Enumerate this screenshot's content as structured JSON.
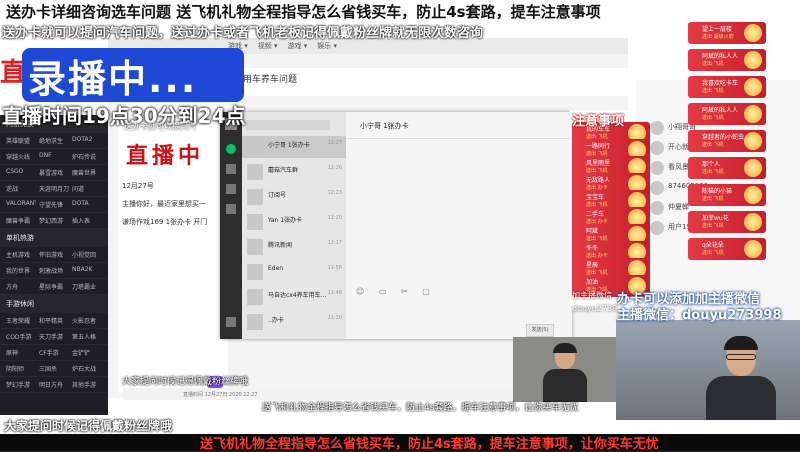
{
  "top_banner": "送办卡详细咨询选车问题  送飞机礼物全程指导怎么省钱买车，防止4s套路，提车注意事项",
  "line2": "送办卡就可以提问汽车问题，送过办卡或者飞机老板记得佩戴粉丝牌就无限次数咨询",
  "recording_label": "录播中...",
  "live_time": "直播时间19点30分到24点",
  "left_red_text": "直",
  "doc_red_text": "直播中",
  "sidebar_overlay_text": "送办卡就可以提问汽",
  "browser": {
    "nav": [
      "游戏 ▾",
      "视频 ▾",
      "游戏 ▾",
      "娱乐 ▾"
    ],
    "page_title": "用车养车问题",
    "doc_lines": [
      "12月27号",
      "主播你好，最近家里想买一",
      "谦场作戏169  1张办卡 开门"
    ]
  },
  "left_sidebar": {
    "sections": [
      {
        "title": "网游竞技",
        "rows": [
          [
            "英雄联盟",
            "绝地求生",
            "DOTA2"
          ],
          [
            "穿越火线",
            "DNF",
            "炉石传说"
          ],
          [
            "CSGO",
            "暴雪游戏",
            "魔兽世界"
          ],
          [
            "逆战",
            "天涯明月刀",
            "问道"
          ],
          [
            "VALORANT",
            "守望先锋",
            "DOTA"
          ],
          [
            "魔兽争霸",
            "梦幻西游",
            "插入表"
          ]
        ]
      },
      {
        "title": "单机热游",
        "rows": [
          [
            "主机游戏",
            "怀旧游戏",
            "小视觉回"
          ],
          [
            "我的世界",
            "刺激战场",
            "NBA2K"
          ],
          [
            "方舟",
            "星际争霸",
            "刀塔霸业"
          ]
        ]
      },
      {
        "title": "手游休闲",
        "rows": [
          [
            "王者荣耀",
            "和平精英",
            "火影忍者"
          ],
          [
            "COD手游",
            "天刀手游",
            "第五人格"
          ],
          [
            "原神",
            "CF手游",
            "金铲铲"
          ],
          [
            "阴阳师",
            "三国杀",
            "炉石大战"
          ],
          [
            "梦幻手游",
            "明日方舟",
            "其他手游"
          ]
        ]
      }
    ]
  },
  "chat_window": {
    "title": "小宁哥 1张办卡",
    "send_label": "发送(S)",
    "tools": "☺ ▭ ✂ ▢",
    "items": [
      {
        "name": "小宁哥 1张办卡",
        "time": "12:27",
        "preview": ""
      },
      {
        "name": "蘑菇汽车群",
        "time": "12:26",
        "preview": ""
      },
      {
        "name": "订阅号",
        "time": "12:23",
        "preview": ""
      },
      {
        "name": "Yan 1张办卡",
        "time": "12:20",
        "preview": ""
      },
      {
        "name": "腾讯新闻",
        "time": "12:17",
        "preview": ""
      },
      {
        "name": "Eden",
        "time": "11:58",
        "preview": ""
      },
      {
        "name": "马自达cx4养车用车...",
        "time": "11:46",
        "preview": ""
      },
      {
        "name": "..办卡",
        "time": "11:30",
        "preview": ""
      }
    ]
  },
  "subtitle_red": "注意事项",
  "rank_list": [
    {
      "name": "小翔哥哥"
    },
    {
      "name": "开心就好"
    },
    {
      "name": "看风景"
    },
    {
      "name": "874605800"
    },
    {
      "name": "仲夏蝉"
    },
    {
      "name": "用户1920"
    }
  ],
  "gifts_left": [
    {
      "name": "我的车车",
      "sub": "送出 飞机"
    },
    {
      "name": "一路同行",
      "sub": "送出 飞机"
    },
    {
      "name": "风里雨里",
      "sub": "送出 飞机"
    },
    {
      "name": "无敌路人",
      "sub": "送出 办卡"
    },
    {
      "name": "宝宝车",
      "sub": "送出 飞机"
    },
    {
      "name": "二手车",
      "sub": "送出 办卡"
    },
    {
      "name": "阿斌",
      "sub": "送出 飞机"
    },
    {
      "name": "冬冬",
      "sub": "送出 办卡"
    },
    {
      "name": "星辰",
      "sub": "送出 飞机"
    },
    {
      "name": "加油",
      "sub": "送出 飞机"
    }
  ],
  "gifts_right": [
    {
      "name": "望上一层楼",
      "sub": "送出 超级火箭"
    },
    {
      "name": "阿斌的私人人",
      "sub": "送出 飞机"
    },
    {
      "name": "我喜欢吃卡车",
      "sub": "送出 飞机"
    },
    {
      "name": "阿斌的私人人",
      "sub": "送出 飞机"
    },
    {
      "name": "穿越者的小蛇虫",
      "sub": "送出 飞机"
    },
    {
      "name": "那个人",
      "sub": "送出 飞机"
    },
    {
      "name": "陈猫的小猫",
      "sub": "送出 飞机"
    },
    {
      "name": "加菲wu花",
      "sub": "送出 飞机"
    },
    {
      "name": "q朵花朵",
      "sub": "送出 飞机"
    }
  ],
  "wechat_overlay": {
    "line1": "办卡可以添加加主播微信",
    "line2": "主播微信：douyu273998",
    "side1": "加主播微信",
    "side2": "douyu2739"
  },
  "caption_mid": "大家提问时候记得佩戴粉丝牌哦",
  "caption_left": "大家提问时候记得佩戴粉丝牌哦",
  "cam_ticker": "送飞机礼物全程指导怎么省钱买车，防止4s套路，提车注意事项，让你买车无忧",
  "bottom_ticker": "送飞机礼物全程指导怎么省钱买车，防止4s套路，提车注意事项，让你买车无忧",
  "player_bar_text": "直播时间   12月27日  2020.12.27",
  "colors": {
    "gift": "#e43a45",
    "recording": "#1d49d6",
    "ticker": "#ff3b2f"
  }
}
